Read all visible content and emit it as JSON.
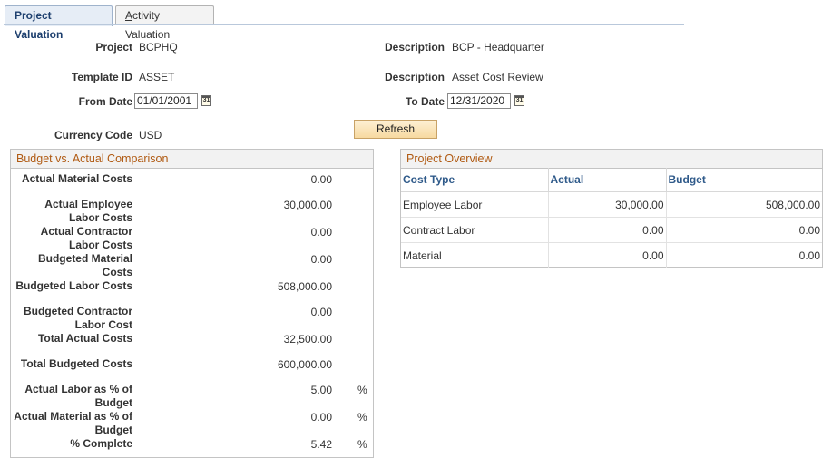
{
  "tabs": [
    {
      "label": "Project Valuation",
      "active": true
    },
    {
      "label": "Activity Valuation",
      "active": false,
      "accesskey": "A",
      "rest": "ctivity Valuation"
    }
  ],
  "header": {
    "project_label": "Project",
    "project_value": "BCPHQ",
    "description_label": "Description",
    "description_value": "BCP - Headquarter",
    "template_label": "Template ID",
    "template_value": "ASSET",
    "description2_label": "Description",
    "description2_value": "Asset Cost Review",
    "from_date_label": "From Date",
    "from_date_value": "01/01/2001",
    "to_date_label": "To Date",
    "to_date_value": "12/31/2020",
    "currency_label": "Currency Code",
    "currency_value": "USD",
    "refresh_label": "Refresh",
    "calendar_glyph": "31"
  },
  "budget": {
    "title": "Budget vs. Actual Comparison",
    "rows": [
      {
        "label": "Actual Material Costs",
        "value": "0.00",
        "unit": ""
      },
      {
        "label": "Actual Employee Labor Costs",
        "value": "30,000.00",
        "unit": ""
      },
      {
        "label": "Actual Contractor Labor Costs",
        "value": "0.00",
        "unit": ""
      },
      {
        "label": "Budgeted Material Costs",
        "value": "0.00",
        "unit": ""
      },
      {
        "label": "Budgeted Labor Costs",
        "value": "508,000.00",
        "unit": ""
      },
      {
        "label": "Budgeted Contractor Labor Cost",
        "value": "0.00",
        "unit": ""
      },
      {
        "label": "Total Actual Costs",
        "value": "32,500.00",
        "unit": ""
      },
      {
        "label": "Total Budgeted Costs",
        "value": "600,000.00",
        "unit": ""
      },
      {
        "label": "Actual Labor as % of Budget",
        "value": "5.00",
        "unit": "%"
      },
      {
        "label": "Actual Material as % of Budget",
        "value": "0.00",
        "unit": "%"
      },
      {
        "label": "% Complete",
        "value": "5.42",
        "unit": "%"
      }
    ]
  },
  "overview": {
    "title": "Project Overview",
    "columns": [
      "Cost Type",
      "Actual",
      "Budget"
    ],
    "rows": [
      [
        "Employee Labor",
        "30,000.00",
        "508,000.00"
      ],
      [
        "Contract Labor",
        "0.00",
        "0.00"
      ],
      [
        "Material",
        "0.00",
        "0.00"
      ]
    ]
  }
}
